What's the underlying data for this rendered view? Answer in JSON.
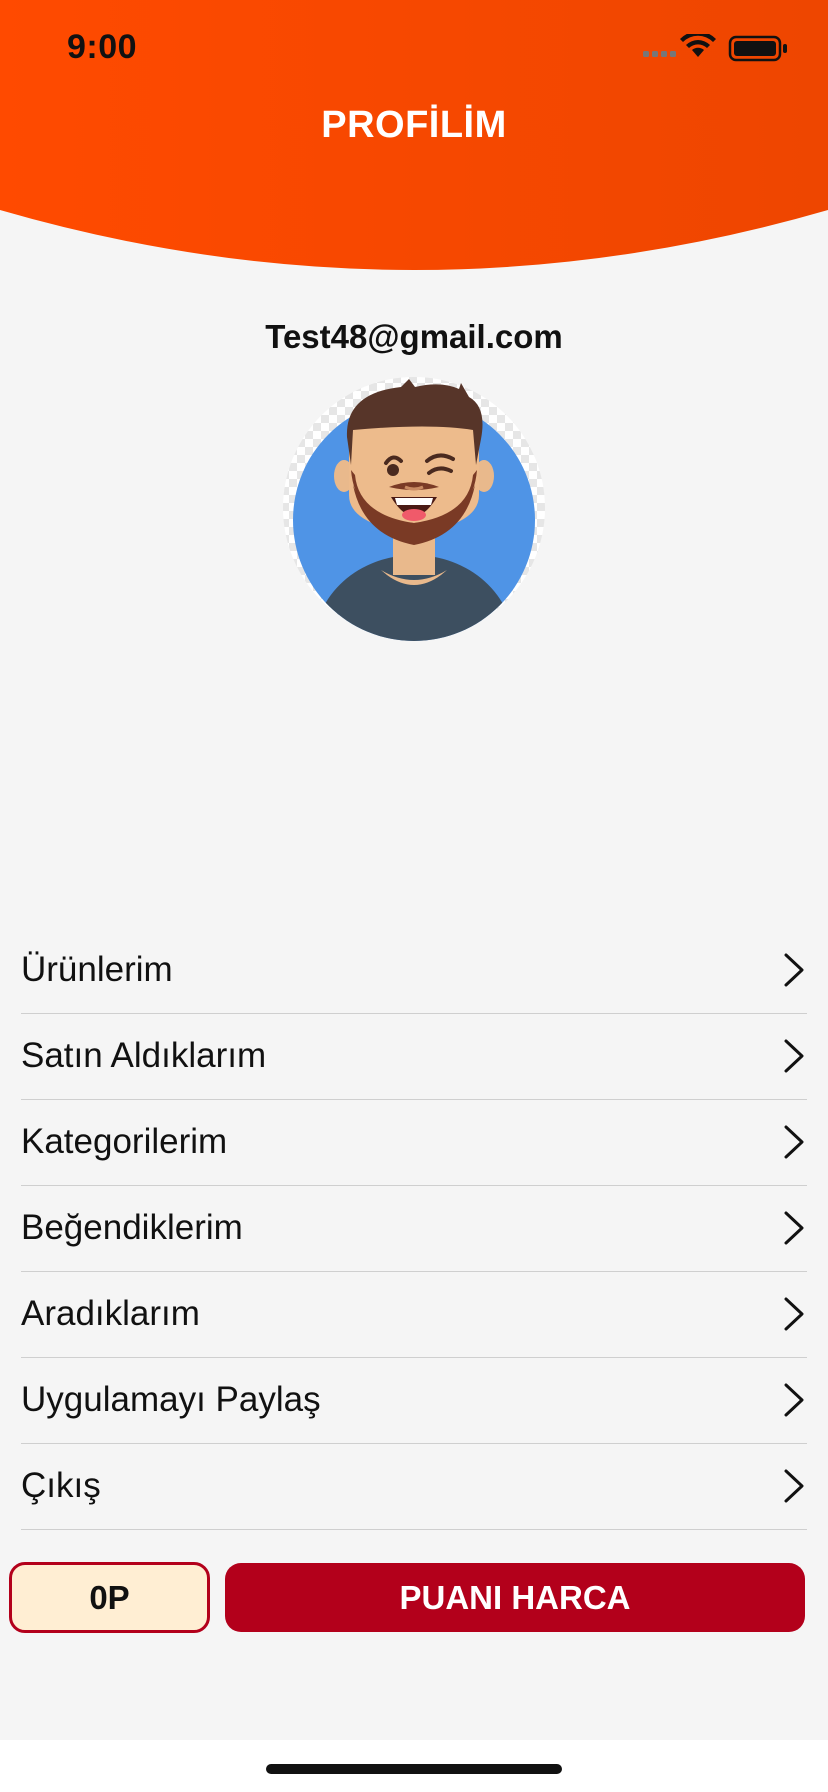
{
  "status_bar": {
    "time": "9:00"
  },
  "header": {
    "title": "PROFİLİM",
    "gradient_start": "#ff4a00",
    "gradient_end": "#ee4600"
  },
  "profile": {
    "email": "Test48@gmail.com",
    "avatar_icon": "winking-bearded-man-avatar"
  },
  "menu": {
    "items": [
      {
        "label": "Ürünlerim",
        "icon": "chevron-right-icon"
      },
      {
        "label": "Satın Aldıklarım",
        "icon": "chevron-right-icon"
      },
      {
        "label": "Kategorilerim",
        "icon": "chevron-right-icon"
      },
      {
        "label": "Beğendiklerim",
        "icon": "chevron-right-icon"
      },
      {
        "label": "Aradıklarım",
        "icon": "chevron-right-icon"
      },
      {
        "label": "Uygulamayı Paylaş",
        "icon": "chevron-right-icon"
      },
      {
        "label": "Çıkış",
        "icon": "chevron-right-icon"
      }
    ]
  },
  "footer": {
    "points": "0P",
    "spend_label": "PUANI HARCA",
    "accent": "#b3001b",
    "badge_bg": "#ffeed3"
  }
}
